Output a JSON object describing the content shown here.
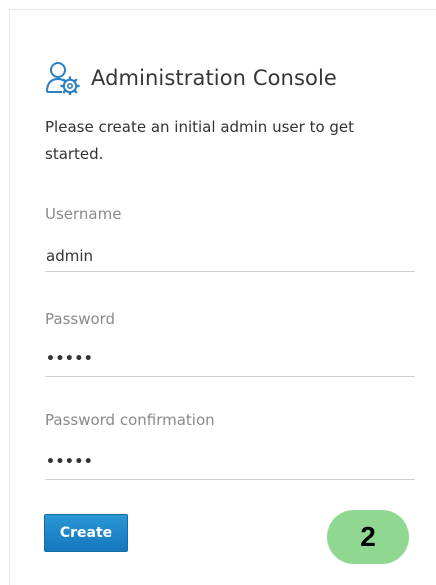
{
  "header": {
    "icon": "user-gear-icon",
    "title": "Administration Console"
  },
  "intro": {
    "text": "Please create an initial admin user to get started."
  },
  "form": {
    "username": {
      "label": "Username",
      "value": "admin"
    },
    "password": {
      "label": "Password",
      "value": "•••••"
    },
    "password_confirmation": {
      "label": "Password confirmation",
      "value": "•••••"
    },
    "create_label": "Create"
  },
  "annotation": {
    "step": "2"
  },
  "colors": {
    "button": "#1a82c5",
    "badge": "#90d792",
    "icon": "#2d7fc3"
  }
}
